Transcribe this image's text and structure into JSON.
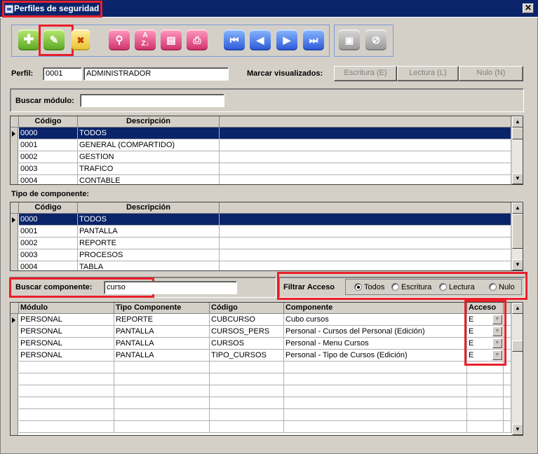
{
  "window": {
    "title": "Perfiles de seguridad",
    "close": "✕"
  },
  "perfil": {
    "label": "Perfil:",
    "code": "0001",
    "name": "ADMINISTRADOR"
  },
  "marcar": {
    "label": "Marcar visualizados:",
    "escritura": "Escritura (E)",
    "lectura": "Lectura (L)",
    "nulo": "Nulo (N)"
  },
  "buscar_modulo": {
    "label": "Buscar módulo:",
    "value": ""
  },
  "modulos": {
    "headers": [
      "Código",
      "Descripción"
    ],
    "rows": [
      [
        "0000",
        "TODOS"
      ],
      [
        "0001",
        "GENERAL (COMPARTIDO)"
      ],
      [
        "0002",
        "GESTION"
      ],
      [
        "0003",
        "TRAFICO"
      ],
      [
        "0004",
        "CONTABLE"
      ]
    ]
  },
  "tipo_componente": {
    "label": "Tipo de componente:",
    "headers": [
      "Código",
      "Descripción"
    ],
    "rows": [
      [
        "0000",
        "TODOS"
      ],
      [
        "0001",
        "PANTALLA"
      ],
      [
        "0002",
        "REPORTE"
      ],
      [
        "0003",
        "PROCESOS"
      ],
      [
        "0004",
        "TABLA"
      ]
    ]
  },
  "buscar_componente": {
    "label": "Buscar componente:",
    "value": "curso"
  },
  "filtrar": {
    "label": "Filtrar Acceso",
    "options": [
      "Todos",
      "Escritura",
      "Lectura",
      "Nulo"
    ],
    "selected": "Todos"
  },
  "componentes": {
    "headers": [
      "Módulo",
      "Tipo Componente",
      "Código",
      "Componente",
      "Acceso"
    ],
    "rows": [
      [
        "PERSONAL",
        "REPORTE",
        "CUBCURSO",
        "Cubo cursos",
        "E"
      ],
      [
        "PERSONAL",
        "PANTALLA",
        "CURSOS_PERS",
        "Personal - Cursos del Personal (Edición)",
        "E"
      ],
      [
        "PERSONAL",
        "PANTALLA",
        "CURSOS",
        "Personal - Menu Cursos",
        "E"
      ],
      [
        "PERSONAL",
        "PANTALLA",
        "TIPO_CURSOS",
        "Personal - Tipo de Cursos (Edición)",
        "E"
      ]
    ]
  },
  "colors": {
    "titlebar": "#0a246a",
    "highlight": "#e8202a",
    "selection": "#0a246a"
  },
  "toolbar_icons": [
    "add-icon",
    "edit-icon",
    "cancel-edit-icon",
    "search-icon",
    "sort-az-icon",
    "report-icon",
    "print-icon",
    "first-record-icon",
    "previous-record-icon",
    "next-record-icon",
    "last-record-icon",
    "save-icon",
    "disable-icon"
  ]
}
